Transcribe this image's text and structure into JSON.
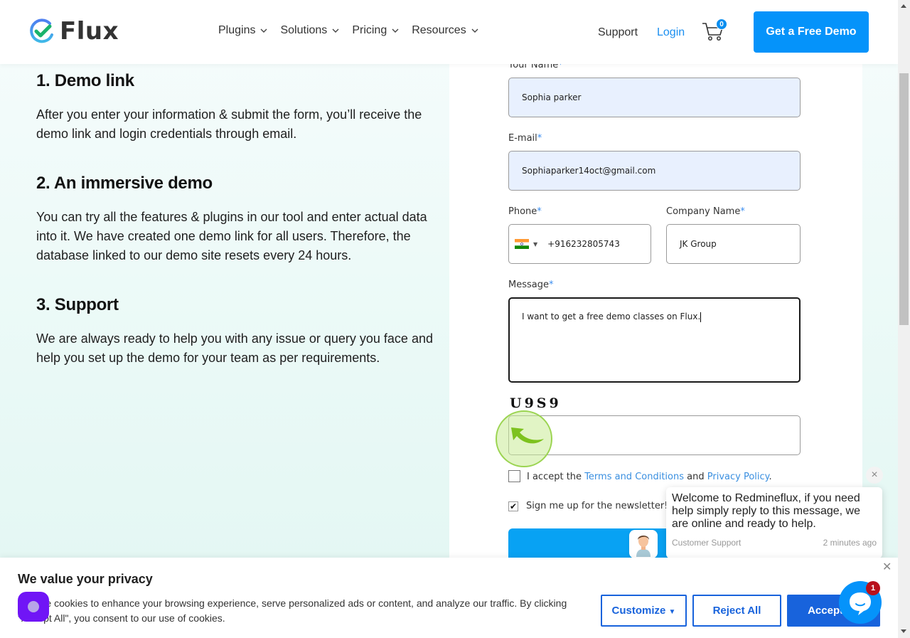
{
  "header": {
    "logo_text": "Flux",
    "nav": [
      {
        "label": "Plugins"
      },
      {
        "label": "Solutions"
      },
      {
        "label": "Pricing"
      },
      {
        "label": "Resources"
      }
    ],
    "support_label": "Support",
    "login_label": "Login",
    "cart_count": "0",
    "cta_label": "Get a Free Demo"
  },
  "sections": [
    {
      "title": "1. Demo link",
      "text": "After you enter your information & submit the form, you’ll receive the demo link and login credentials through email."
    },
    {
      "title": "2. An immersive demo",
      "text": "You can try all the features & plugins in our tool and enter actual data into it. We have created one demo link for all users. Therefore, the database linked to our demo site resets every 24 hours."
    },
    {
      "title": "3. Support",
      "text": "We are always ready to help you with any issue or query you face and help you set up the demo for your team as per requirements."
    }
  ],
  "form": {
    "name_label": "Your Name",
    "name_value": "Sophia parker",
    "email_label": "E-mail",
    "email_value": "Sophiaparker14oct@gmail.com",
    "phone_label": "Phone",
    "phone_value": "+916232805743",
    "phone_country": "India",
    "company_label": "Company Name",
    "company_value": "JK Group",
    "message_label": "Message",
    "message_value": "I want to get a free demo classes on Flux.",
    "required_mark": "*",
    "captcha_text": "U9S9",
    "captcha_value": "",
    "terms_prefix": "I accept the ",
    "terms_link": "Terms and Conditions",
    "terms_and": " and ",
    "privacy_link": "Privacy Policy",
    "terms_suffix": ".",
    "terms_checked": false,
    "newsletter_label": "Sign me up for the newsletter!",
    "newsletter_checked": true
  },
  "chat": {
    "message": "Welcome to Redmineflux, if you need help simply reply to this message, we are online and ready to help.",
    "sender": "Customer Support",
    "time": "2 minutes ago",
    "unread_count": "1"
  },
  "cookie": {
    "title": "We value your privacy",
    "text": "We use cookies to enhance your browsing experience, serve personalized ads or content, and analyze our traffic. By clicking \"Accept All\", you consent to our use of cookies.",
    "customize_label": "Customize",
    "reject_label": "Reject All",
    "accept_label": "Accept All"
  },
  "colors": {
    "brand_blue": "#0593fa",
    "link_blue": "#1b8ff0",
    "cookie_blue": "#1863dc",
    "chat_badge": "#b8101a",
    "widget_purple": "#7015f6"
  }
}
